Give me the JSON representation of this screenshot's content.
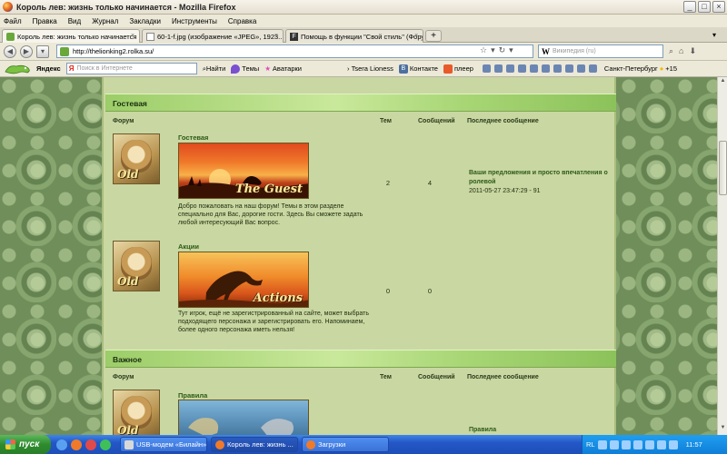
{
  "window": {
    "title": "Король лев: жизнь только начинается - Mozilla Firefox",
    "buttons": {
      "minimize": "_",
      "maximize": "□",
      "close": "×"
    }
  },
  "menu": [
    "Файл",
    "Правка",
    "Вид",
    "Журнал",
    "Закладки",
    "Инструменты",
    "Справка"
  ],
  "tabs": [
    {
      "label": "Король лев: жизнь только начинается",
      "active": true,
      "icon": "lion-site-icon"
    },
    {
      "label": "60-1-f.jpg (изображение «JPEG», 1923...",
      "active": false,
      "icon": "image-icon"
    },
    {
      "label": "Помощь в функции \"Свой стиль\" (Фору...",
      "active": false,
      "icon": "forum-icon"
    }
  ],
  "tabbar": {
    "new_tab": "+",
    "list": "▾"
  },
  "nav": {
    "url": "http://thelionking2.rolka.su/",
    "search_engine": "W",
    "search_placeholder": "Википедия (ru)"
  },
  "yandex": {
    "brand": "Яндекс",
    "search_placeholder": "Поиск в Интернете",
    "find": "Найти",
    "themes": "Темы",
    "avatars": "Аватарки",
    "tsera": "Tsera Lioness",
    "contact": "Контакте",
    "player": "плеер",
    "city": "Санкт-Петербург",
    "temp": "+15"
  },
  "forum": {
    "columns": {
      "forum": "Форум",
      "topics": "Тем",
      "posts": "Сообщений",
      "last": "Последнее сообщение"
    },
    "categories": [
      {
        "name": "Гостевая",
        "forums": [
          {
            "title": "Гостевая",
            "avatar_text": "Old",
            "banner_text": "The Guest",
            "description": "Добро пожаловать на наш форум! Темы в этом разделе специально для Вас, дорогие гости. Здесь Вы сможете задать любой интересующий Вас вопрос.",
            "topics": "2",
            "posts": "4",
            "last_title": "Ваши предложения и просто впечатления о ролевой",
            "last_date": "2011-05-27 23:47:29 - 91"
          },
          {
            "title": "Акции",
            "avatar_text": "Old",
            "banner_text": "Actions",
            "description": "Тут игрок, ещё не зарегистрированный на сайте, может выбрать подходящего персонажа и зарегистрировать его. Напоминаем, более одного персонажа иметь нельзя!",
            "topics": "0",
            "posts": "0",
            "last_title": "",
            "last_date": ""
          }
        ]
      },
      {
        "name": "Важное",
        "forums": [
          {
            "title": "Правила",
            "avatar_text": "Old",
            "banner_text": "",
            "description": "",
            "topics": "",
            "posts": "",
            "last_title": "Правила",
            "last_date": ""
          }
        ]
      }
    ]
  },
  "taskbar": {
    "start": "пуск",
    "buttons": [
      {
        "label": "USB-модем «Билайн»",
        "active": false
      },
      {
        "label": "Король лев: жизнь ...",
        "active": true
      },
      {
        "label": "Загрузки",
        "active": false
      }
    ],
    "lang": "RL",
    "time": "11:57"
  },
  "colors": {
    "accent_green": "#9ccd68",
    "forum_bg": "#c9d7a2",
    "title_link": "#2c5a16",
    "taskbar_blue": "#2457c7"
  }
}
